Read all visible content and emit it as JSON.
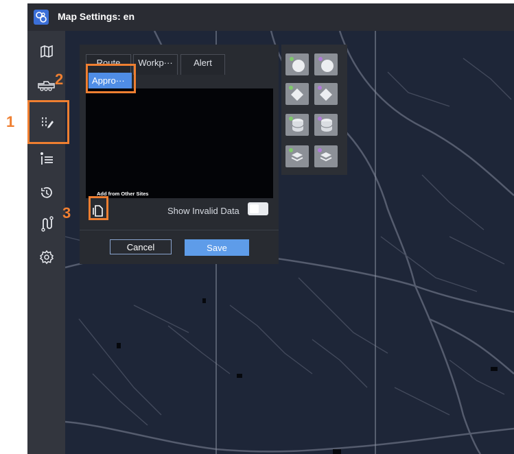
{
  "window": {
    "title": "Map Settings: en"
  },
  "sidebar": {
    "items": [
      {
        "icon": "map-icon"
      },
      {
        "icon": "truck-icon"
      },
      {
        "icon": "map-edit-icon"
      },
      {
        "icon": "list-icon"
      },
      {
        "icon": "history-icon"
      },
      {
        "icon": "route-icon"
      },
      {
        "icon": "settings-icon"
      }
    ]
  },
  "panel": {
    "tabs": [
      "Route",
      "Workp···",
      "Alert"
    ],
    "subtab": "Appro···",
    "add_from_other_sites": "Add from Other Sites",
    "show_invalid_label": "Show Invalid Data",
    "show_invalid_checked": false,
    "cancel_label": "Cancel",
    "save_label": "Save"
  },
  "icon_panel": {
    "icons": [
      "circle-layer-icon",
      "circle-layer-icon",
      "diamond-layer-icon",
      "diamond-layer-icon",
      "cylinder-layer-icon",
      "cylinder-layer-icon",
      "stack-layer-icon",
      "stack-layer-icon"
    ]
  },
  "annotations": {
    "step1": "1",
    "step2": "2",
    "step3": "3",
    "color": "#ef7f31"
  },
  "colors": {
    "accent": "#4f8de6",
    "save_button": "#5e9ce9",
    "map_background": "#1e2638",
    "sidebar": "#33363e",
    "titlebar": "#2a2c33"
  }
}
